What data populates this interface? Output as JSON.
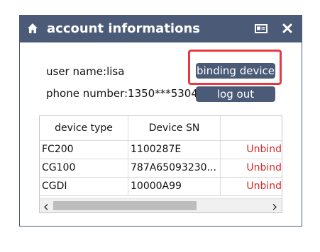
{
  "window": {
    "title": "account informations",
    "icons": {
      "home": "home-icon",
      "card": "id-card-icon",
      "close": "close-icon"
    }
  },
  "account": {
    "user_label": "user name:lisa",
    "phone_label": "phone number:1350***5304"
  },
  "actions": {
    "binding_label": "binding device",
    "logout_label": "log out"
  },
  "table": {
    "headers": [
      "device type",
      "Device SN",
      ""
    ],
    "rows": [
      {
        "type": "FC200",
        "sn": "1100287E",
        "action": "Unbind"
      },
      {
        "type": "CG100",
        "sn": "787A65093230...",
        "action": "Unbind"
      },
      {
        "type": "CGDI",
        "sn": "10000A99",
        "action": "Unbind"
      }
    ]
  },
  "colors": {
    "titlebar": "#4a5a77",
    "button": "#4a5a77",
    "unbind_text": "#d42a2a",
    "highlight": "#e8383d"
  }
}
